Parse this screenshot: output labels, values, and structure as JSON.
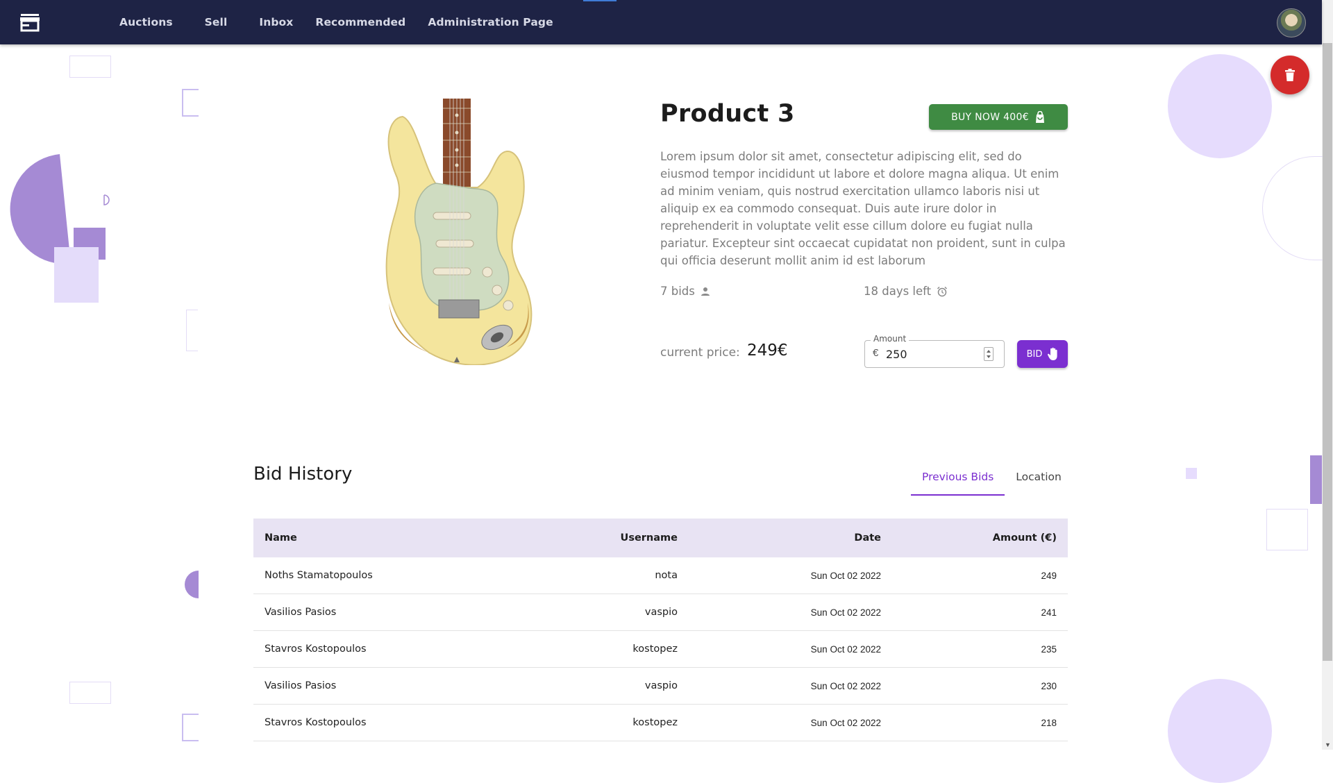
{
  "nav": {
    "items": [
      "Auctions",
      "Sell",
      "Inbox",
      "Recommended",
      "Administration Page"
    ]
  },
  "product": {
    "title": "Product 3",
    "buy_now_label": "BUY NOW 400€",
    "description": "Lorem ipsum dolor sit amet, consectetur adipiscing elit, sed do eiusmod tempor incididunt ut labore et dolore magna aliqua. Ut enim ad minim veniam, quis nostrud exercitation ullamco laboris nisi ut aliquip ex ea commodo consequat. Duis aute irure dolor in reprehenderit in voluptate velit esse cillum dolore eu fugiat nulla pariatur. Excepteur sint occaecat cupidatat non proident, sunt in culpa qui officia deserunt mollit anim id est laborum",
    "bids_text": "7 bids",
    "time_left_text": "18 days left",
    "current_price_label": "current price:",
    "current_price": "249€"
  },
  "bid_form": {
    "amount_label": "Amount",
    "currency_symbol": "€",
    "amount_value": "250",
    "bid_label": "BID"
  },
  "history": {
    "title": "Bid History",
    "tabs": [
      "Previous Bids",
      "Location"
    ],
    "active_tab": "Previous Bids",
    "columns": [
      "Name",
      "Username",
      "Date",
      "Amount (€)"
    ],
    "rows": [
      {
        "name": "Noths Stamatopoulos",
        "username": "nota",
        "date": "Sun Oct 02 2022",
        "amount": "249"
      },
      {
        "name": "Vasilios Pasios",
        "username": "vaspio",
        "date": "Sun Oct 02 2022",
        "amount": "241"
      },
      {
        "name": "Stavros Kostopoulos",
        "username": "kostopez",
        "date": "Sun Oct 02 2022",
        "amount": "235"
      },
      {
        "name": "Vasilios Pasios",
        "username": "vaspio",
        "date": "Sun Oct 02 2022",
        "amount": "230"
      },
      {
        "name": "Stavros Kostopoulos",
        "username": "kostopez",
        "date": "Sun Oct 02 2022",
        "amount": "218"
      }
    ]
  },
  "colors": {
    "navbar": "#1e2345",
    "accent_purple": "#7b2fd0",
    "buy_green": "#3f8b43",
    "delete_red": "#d42b2b",
    "table_header": "#e8e3f3"
  },
  "icons": {
    "logo": "store-icon",
    "buy": "shopping-bag-icon",
    "bids": "person-icon",
    "time": "alarm-clock-icon",
    "bid": "hand-icon",
    "delete": "trash-icon"
  }
}
